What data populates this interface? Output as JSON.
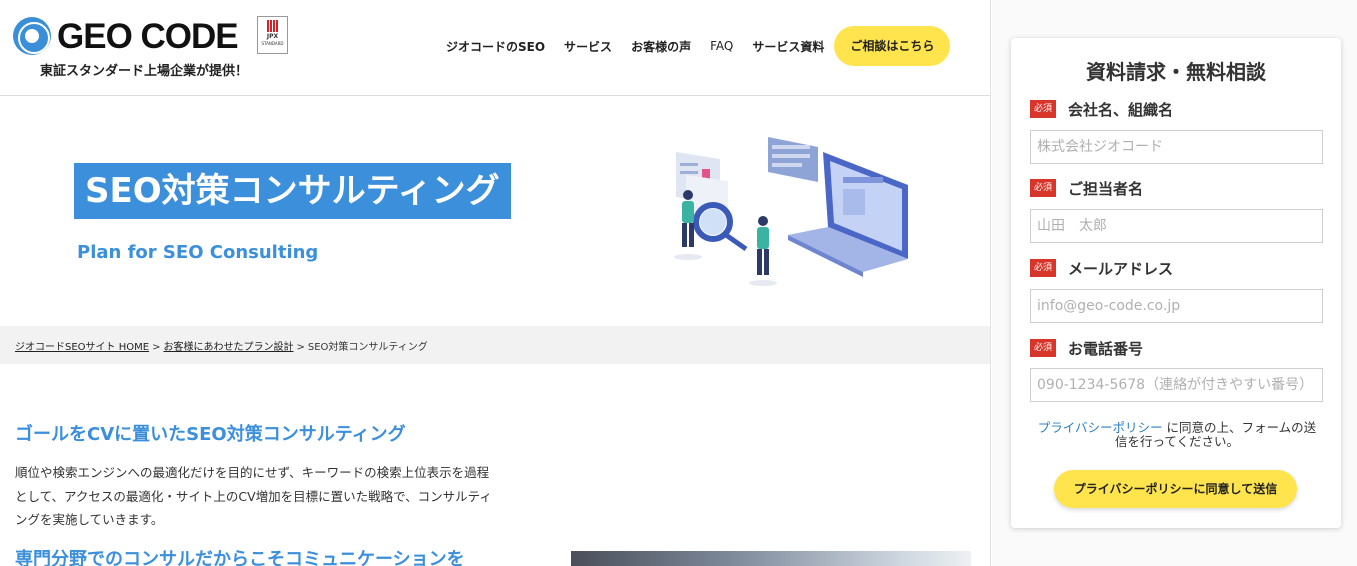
{
  "header": {
    "logo_text": "GEO CODE",
    "jpx_badge": "JPX",
    "jpx_sub": "STANDARD",
    "tagline": "東証スタンダード上場企業が提供！",
    "nav": [
      "ジオコードのSEO",
      "サービス",
      "お客様の声",
      "FAQ",
      "サービス資料"
    ],
    "cta": "ご相談はこちら"
  },
  "hero": {
    "title": "SEO対策コンサルティング",
    "subtitle": "Plan for SEO Consulting"
  },
  "breadcrumb": {
    "items": [
      "ジオコードSEOサイト HOME",
      "お客様にあわせたプラン設計"
    ],
    "current": "SEO対策コンサルティング",
    "separator": ">"
  },
  "content": {
    "heading": "ゴールをCVに置いたSEO対策コンサルティング",
    "paragraph": "順位や検索エンジンへの最適化だけを目的にせず、キーワードの検索上位表示を過程として、アクセスの最適化・サイト上のCV増加を目標に置いた戦略で、コンサルティングを実施していきます。",
    "heading2": "専門分野でのコンサルだからこそコミュニケーションを"
  },
  "form": {
    "title": "資料請求・無料相談",
    "required_label": "必須",
    "fields": [
      {
        "label": "会社名、組織名",
        "placeholder": "株式会社ジオコード"
      },
      {
        "label": "ご担当者名",
        "placeholder": "山田　太郎"
      },
      {
        "label": "メールアドレス",
        "placeholder": "info@geo-code.co.jp"
      },
      {
        "label": "お電話番号",
        "placeholder": "090-1234-5678（連絡が付きやすい番号）"
      }
    ],
    "privacy_link": "プライバシーポリシー",
    "privacy_text": "に同意の上、フォームの送信を行ってください。",
    "submit": "プライバシーポリシーに同意して送信"
  },
  "colors": {
    "accent_blue": "#3b8fdb",
    "cta_yellow": "#ffe44d",
    "required_red": "#d9362b"
  }
}
